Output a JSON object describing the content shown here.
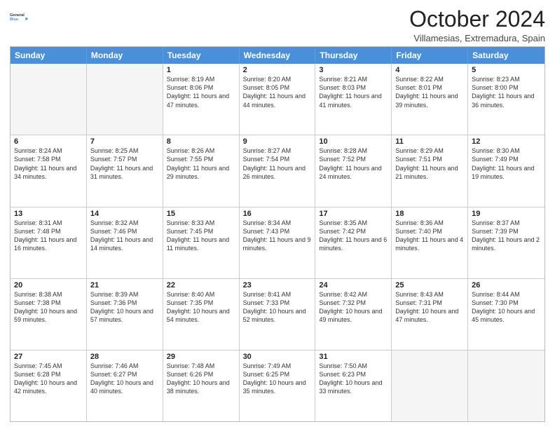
{
  "logo": {
    "text_general": "General",
    "text_blue": "Blue"
  },
  "header": {
    "month_title": "October 2024",
    "location": "Villamesias, Extremadura, Spain"
  },
  "days_of_week": [
    "Sunday",
    "Monday",
    "Tuesday",
    "Wednesday",
    "Thursday",
    "Friday",
    "Saturday"
  ],
  "rows": [
    [
      {
        "day": "",
        "empty": true
      },
      {
        "day": "",
        "empty": true
      },
      {
        "day": "1",
        "sunrise": "Sunrise: 8:19 AM",
        "sunset": "Sunset: 8:06 PM",
        "daylight": "Daylight: 11 hours and 47 minutes."
      },
      {
        "day": "2",
        "sunrise": "Sunrise: 8:20 AM",
        "sunset": "Sunset: 8:05 PM",
        "daylight": "Daylight: 11 hours and 44 minutes."
      },
      {
        "day": "3",
        "sunrise": "Sunrise: 8:21 AM",
        "sunset": "Sunset: 8:03 PM",
        "daylight": "Daylight: 11 hours and 41 minutes."
      },
      {
        "day": "4",
        "sunrise": "Sunrise: 8:22 AM",
        "sunset": "Sunset: 8:01 PM",
        "daylight": "Daylight: 11 hours and 39 minutes."
      },
      {
        "day": "5",
        "sunrise": "Sunrise: 8:23 AM",
        "sunset": "Sunset: 8:00 PM",
        "daylight": "Daylight: 11 hours and 36 minutes."
      }
    ],
    [
      {
        "day": "6",
        "sunrise": "Sunrise: 8:24 AM",
        "sunset": "Sunset: 7:58 PM",
        "daylight": "Daylight: 11 hours and 34 minutes."
      },
      {
        "day": "7",
        "sunrise": "Sunrise: 8:25 AM",
        "sunset": "Sunset: 7:57 PM",
        "daylight": "Daylight: 11 hours and 31 minutes."
      },
      {
        "day": "8",
        "sunrise": "Sunrise: 8:26 AM",
        "sunset": "Sunset: 7:55 PM",
        "daylight": "Daylight: 11 hours and 29 minutes."
      },
      {
        "day": "9",
        "sunrise": "Sunrise: 8:27 AM",
        "sunset": "Sunset: 7:54 PM",
        "daylight": "Daylight: 11 hours and 26 minutes."
      },
      {
        "day": "10",
        "sunrise": "Sunrise: 8:28 AM",
        "sunset": "Sunset: 7:52 PM",
        "daylight": "Daylight: 11 hours and 24 minutes."
      },
      {
        "day": "11",
        "sunrise": "Sunrise: 8:29 AM",
        "sunset": "Sunset: 7:51 PM",
        "daylight": "Daylight: 11 hours and 21 minutes."
      },
      {
        "day": "12",
        "sunrise": "Sunrise: 8:30 AM",
        "sunset": "Sunset: 7:49 PM",
        "daylight": "Daylight: 11 hours and 19 minutes."
      }
    ],
    [
      {
        "day": "13",
        "sunrise": "Sunrise: 8:31 AM",
        "sunset": "Sunset: 7:48 PM",
        "daylight": "Daylight: 11 hours and 16 minutes."
      },
      {
        "day": "14",
        "sunrise": "Sunrise: 8:32 AM",
        "sunset": "Sunset: 7:46 PM",
        "daylight": "Daylight: 11 hours and 14 minutes."
      },
      {
        "day": "15",
        "sunrise": "Sunrise: 8:33 AM",
        "sunset": "Sunset: 7:45 PM",
        "daylight": "Daylight: 11 hours and 11 minutes."
      },
      {
        "day": "16",
        "sunrise": "Sunrise: 8:34 AM",
        "sunset": "Sunset: 7:43 PM",
        "daylight": "Daylight: 11 hours and 9 minutes."
      },
      {
        "day": "17",
        "sunrise": "Sunrise: 8:35 AM",
        "sunset": "Sunset: 7:42 PM",
        "daylight": "Daylight: 11 hours and 6 minutes."
      },
      {
        "day": "18",
        "sunrise": "Sunrise: 8:36 AM",
        "sunset": "Sunset: 7:40 PM",
        "daylight": "Daylight: 11 hours and 4 minutes."
      },
      {
        "day": "19",
        "sunrise": "Sunrise: 8:37 AM",
        "sunset": "Sunset: 7:39 PM",
        "daylight": "Daylight: 11 hours and 2 minutes."
      }
    ],
    [
      {
        "day": "20",
        "sunrise": "Sunrise: 8:38 AM",
        "sunset": "Sunset: 7:38 PM",
        "daylight": "Daylight: 10 hours and 59 minutes."
      },
      {
        "day": "21",
        "sunrise": "Sunrise: 8:39 AM",
        "sunset": "Sunset: 7:36 PM",
        "daylight": "Daylight: 10 hours and 57 minutes."
      },
      {
        "day": "22",
        "sunrise": "Sunrise: 8:40 AM",
        "sunset": "Sunset: 7:35 PM",
        "daylight": "Daylight: 10 hours and 54 minutes."
      },
      {
        "day": "23",
        "sunrise": "Sunrise: 8:41 AM",
        "sunset": "Sunset: 7:33 PM",
        "daylight": "Daylight: 10 hours and 52 minutes."
      },
      {
        "day": "24",
        "sunrise": "Sunrise: 8:42 AM",
        "sunset": "Sunset: 7:32 PM",
        "daylight": "Daylight: 10 hours and 49 minutes."
      },
      {
        "day": "25",
        "sunrise": "Sunrise: 8:43 AM",
        "sunset": "Sunset: 7:31 PM",
        "daylight": "Daylight: 10 hours and 47 minutes."
      },
      {
        "day": "26",
        "sunrise": "Sunrise: 8:44 AM",
        "sunset": "Sunset: 7:30 PM",
        "daylight": "Daylight: 10 hours and 45 minutes."
      }
    ],
    [
      {
        "day": "27",
        "sunrise": "Sunrise: 7:45 AM",
        "sunset": "Sunset: 6:28 PM",
        "daylight": "Daylight: 10 hours and 42 minutes."
      },
      {
        "day": "28",
        "sunrise": "Sunrise: 7:46 AM",
        "sunset": "Sunset: 6:27 PM",
        "daylight": "Daylight: 10 hours and 40 minutes."
      },
      {
        "day": "29",
        "sunrise": "Sunrise: 7:48 AM",
        "sunset": "Sunset: 6:26 PM",
        "daylight": "Daylight: 10 hours and 38 minutes."
      },
      {
        "day": "30",
        "sunrise": "Sunrise: 7:49 AM",
        "sunset": "Sunset: 6:25 PM",
        "daylight": "Daylight: 10 hours and 35 minutes."
      },
      {
        "day": "31",
        "sunrise": "Sunrise: 7:50 AM",
        "sunset": "Sunset: 6:23 PM",
        "daylight": "Daylight: 10 hours and 33 minutes."
      },
      {
        "day": "",
        "empty": true
      },
      {
        "day": "",
        "empty": true
      }
    ]
  ]
}
